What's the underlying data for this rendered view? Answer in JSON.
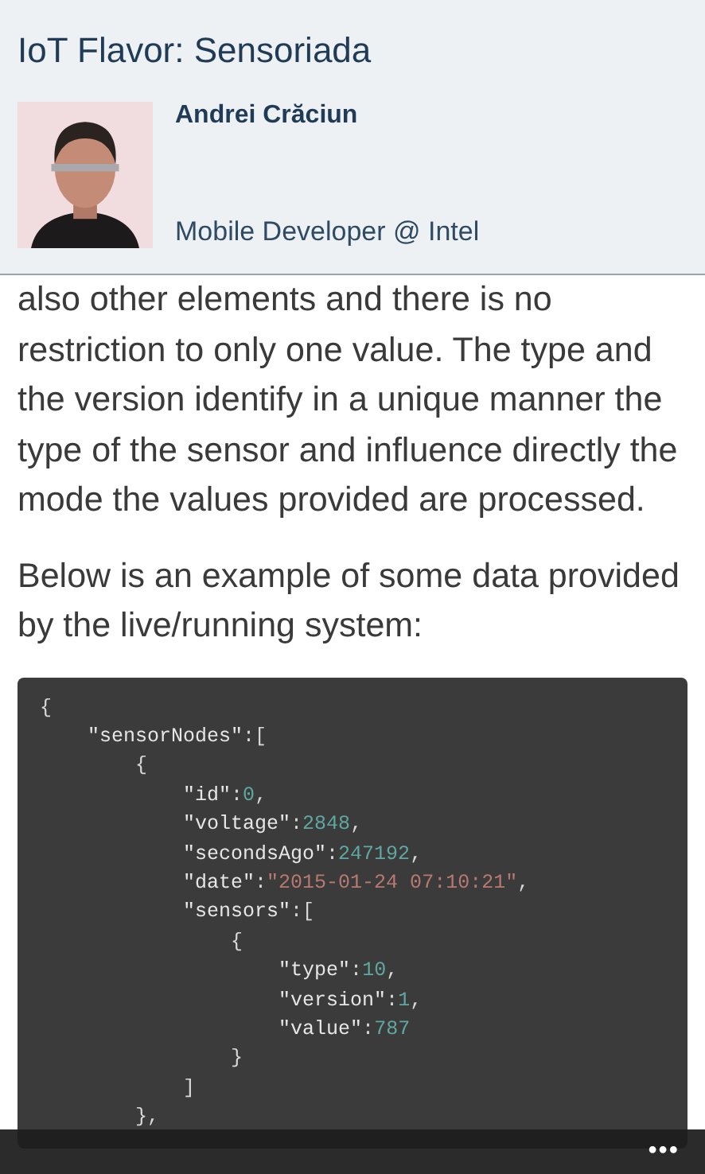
{
  "header": {
    "title": "IoT Flavor: Sensoriada",
    "author": {
      "name": "Andrei Crăciun",
      "role": "Mobile Developer @ Intel"
    }
  },
  "article": {
    "paragraphs": [
      "also other elements and there is no restriction to only one value. The type and the version identify in a unique manner the type of the sensor and influence directly the mode the values provided are processed.",
      "Below is an example of some data provided by the live/running system:"
    ],
    "code_lines": [
      [
        {
          "kind": "punct",
          "text": "{"
        }
      ],
      [
        {
          "kind": "key",
          "text": "    \"sensorNodes\""
        },
        {
          "kind": "punct",
          "text": ":["
        }
      ],
      [
        {
          "kind": "punct",
          "text": "        {"
        }
      ],
      [
        {
          "kind": "key",
          "text": "            \"id\""
        },
        {
          "kind": "punct",
          "text": ":"
        },
        {
          "kind": "number",
          "text": "0"
        },
        {
          "kind": "punct",
          "text": ","
        }
      ],
      [
        {
          "kind": "key",
          "text": "            \"voltage\""
        },
        {
          "kind": "punct",
          "text": ":"
        },
        {
          "kind": "number",
          "text": "2848"
        },
        {
          "kind": "punct",
          "text": ","
        }
      ],
      [
        {
          "kind": "key",
          "text": "            \"secondsAgo\""
        },
        {
          "kind": "punct",
          "text": ":"
        },
        {
          "kind": "number",
          "text": "247192"
        },
        {
          "kind": "punct",
          "text": ","
        }
      ],
      [
        {
          "kind": "key",
          "text": "            \"date\""
        },
        {
          "kind": "punct",
          "text": ":"
        },
        {
          "kind": "string",
          "text": "\"2015-01-24 07:10:21\""
        },
        {
          "kind": "punct",
          "text": ","
        }
      ],
      [
        {
          "kind": "key",
          "text": "            \"sensors\""
        },
        {
          "kind": "punct",
          "text": ":["
        }
      ],
      [
        {
          "kind": "punct",
          "text": "                {"
        }
      ],
      [
        {
          "kind": "key",
          "text": "                    \"type\""
        },
        {
          "kind": "punct",
          "text": ":"
        },
        {
          "kind": "number",
          "text": "10"
        },
        {
          "kind": "punct",
          "text": ","
        }
      ],
      [
        {
          "kind": "key",
          "text": "                    \"version\""
        },
        {
          "kind": "punct",
          "text": ":"
        },
        {
          "kind": "number",
          "text": "1"
        },
        {
          "kind": "punct",
          "text": ","
        }
      ],
      [
        {
          "kind": "key",
          "text": "                    \"value\""
        },
        {
          "kind": "punct",
          "text": ":"
        },
        {
          "kind": "number",
          "text": "787"
        }
      ],
      [
        {
          "kind": "punct",
          "text": "                }"
        }
      ],
      [
        {
          "kind": "punct",
          "text": "            ]"
        }
      ],
      [
        {
          "kind": "punct",
          "text": "        },"
        }
      ]
    ]
  },
  "app_bar": {
    "more": "•••"
  }
}
